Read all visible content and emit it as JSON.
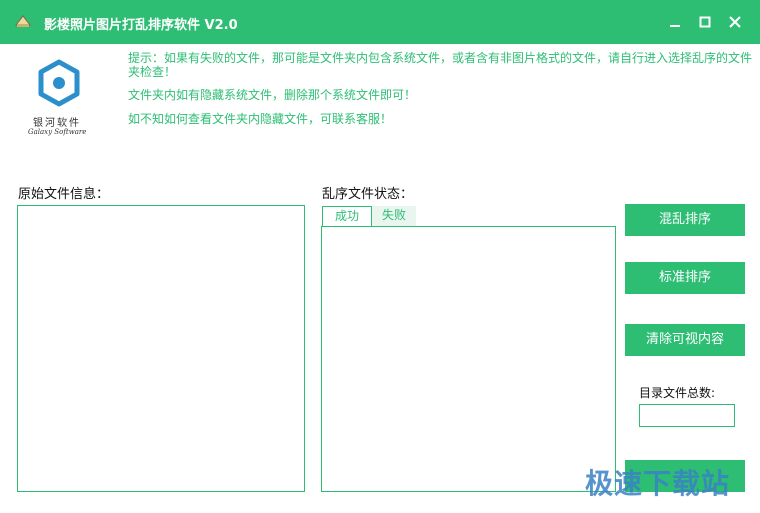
{
  "window": {
    "title": "影楼照片图片打乱排序软件 V2.0",
    "accent_color": "#2dbe74",
    "controls": [
      "minimize-icon",
      "maximize-icon",
      "close-icon"
    ]
  },
  "logo": {
    "name_cn": "银河软件",
    "name_en": "Galaxy Software"
  },
  "tips": [
    "提示：如果有失败的文件，那可能是文件夹内包含系统文件，或者含有非图片格式的文件，请自行进入选择乱序的文件夹检查！",
    "文件夹内如有隐藏系统文件，删除那个系统文件即可！",
    "如不知如何查看文件夹内隐藏文件，可联系客服！"
  ],
  "original_panel": {
    "label": "原始文件信息："
  },
  "shuffle_panel": {
    "label": "乱序文件状态：",
    "tabs": [
      {
        "label": "成功",
        "active": true
      },
      {
        "label": "失败",
        "active": false
      }
    ]
  },
  "actions": {
    "shuffle": "混乱排序",
    "standard": "标准排序",
    "clear": "清除可视内容",
    "count_label": "目录文件总数:",
    "count_value": ""
  },
  "watermark": "极速下载站"
}
